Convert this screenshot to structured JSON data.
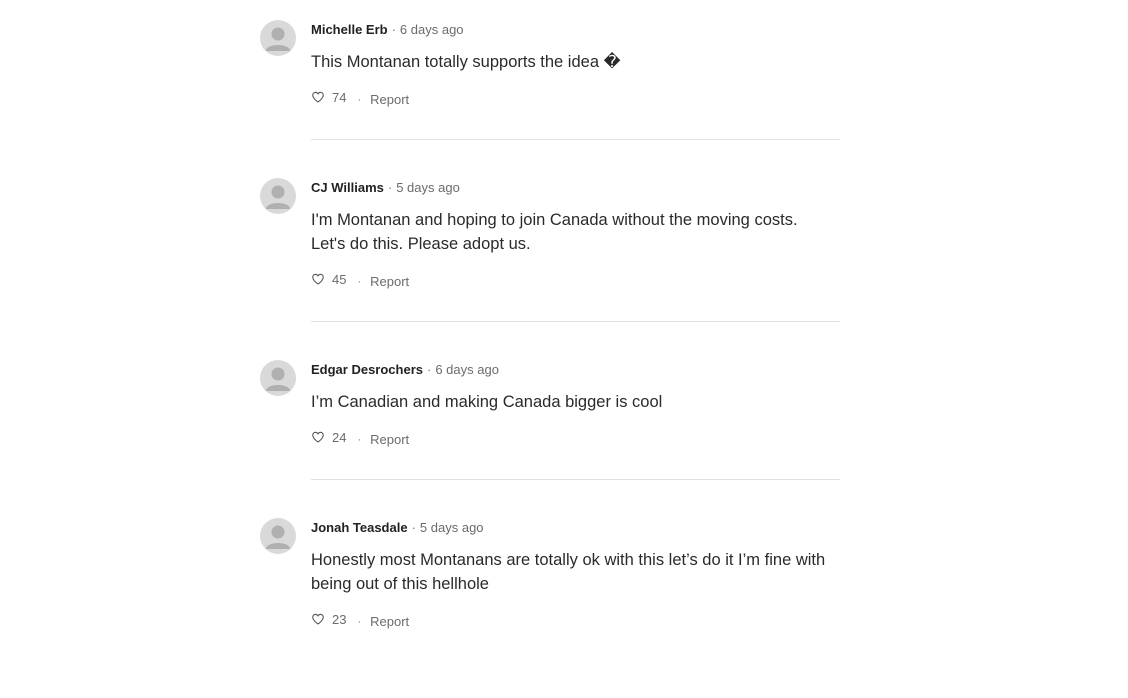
{
  "comments": [
    {
      "author": "Michelle Erb",
      "separator": "·",
      "time": "6 days ago",
      "text": "This Montanan totally supports the idea �",
      "likes": "74",
      "dot": "·",
      "report_label": "Report"
    },
    {
      "author": "CJ Williams",
      "separator": "·",
      "time": "5 days ago",
      "text": "I'm Montanan and hoping to join Canada without the moving costs. Let's do this. Please adopt us.",
      "likes": "45",
      "dot": "·",
      "report_label": "Report"
    },
    {
      "author": "Edgar Desrochers",
      "separator": "·",
      "time": "6 days ago",
      "text": "I’m Canadian and making Canada bigger is cool",
      "likes": "24",
      "dot": "·",
      "report_label": "Report"
    },
    {
      "author": "Jonah Teasdale",
      "separator": "·",
      "time": "5 days ago",
      "text": "Honestly most Montanans are totally ok with this let’s do it I’m fine with being out of this hellhole",
      "likes": "23",
      "dot": "·",
      "report_label": "Report"
    }
  ],
  "icons": {
    "avatar": "default-user-avatar-icon",
    "like": "heart-outline-icon"
  },
  "colors": {
    "author": "#222222",
    "meta": "#6b6b6b",
    "divider": "#e2e2e2",
    "avatar_bg": "#d9d9d9",
    "avatar_fg": "#b0b0b0"
  }
}
